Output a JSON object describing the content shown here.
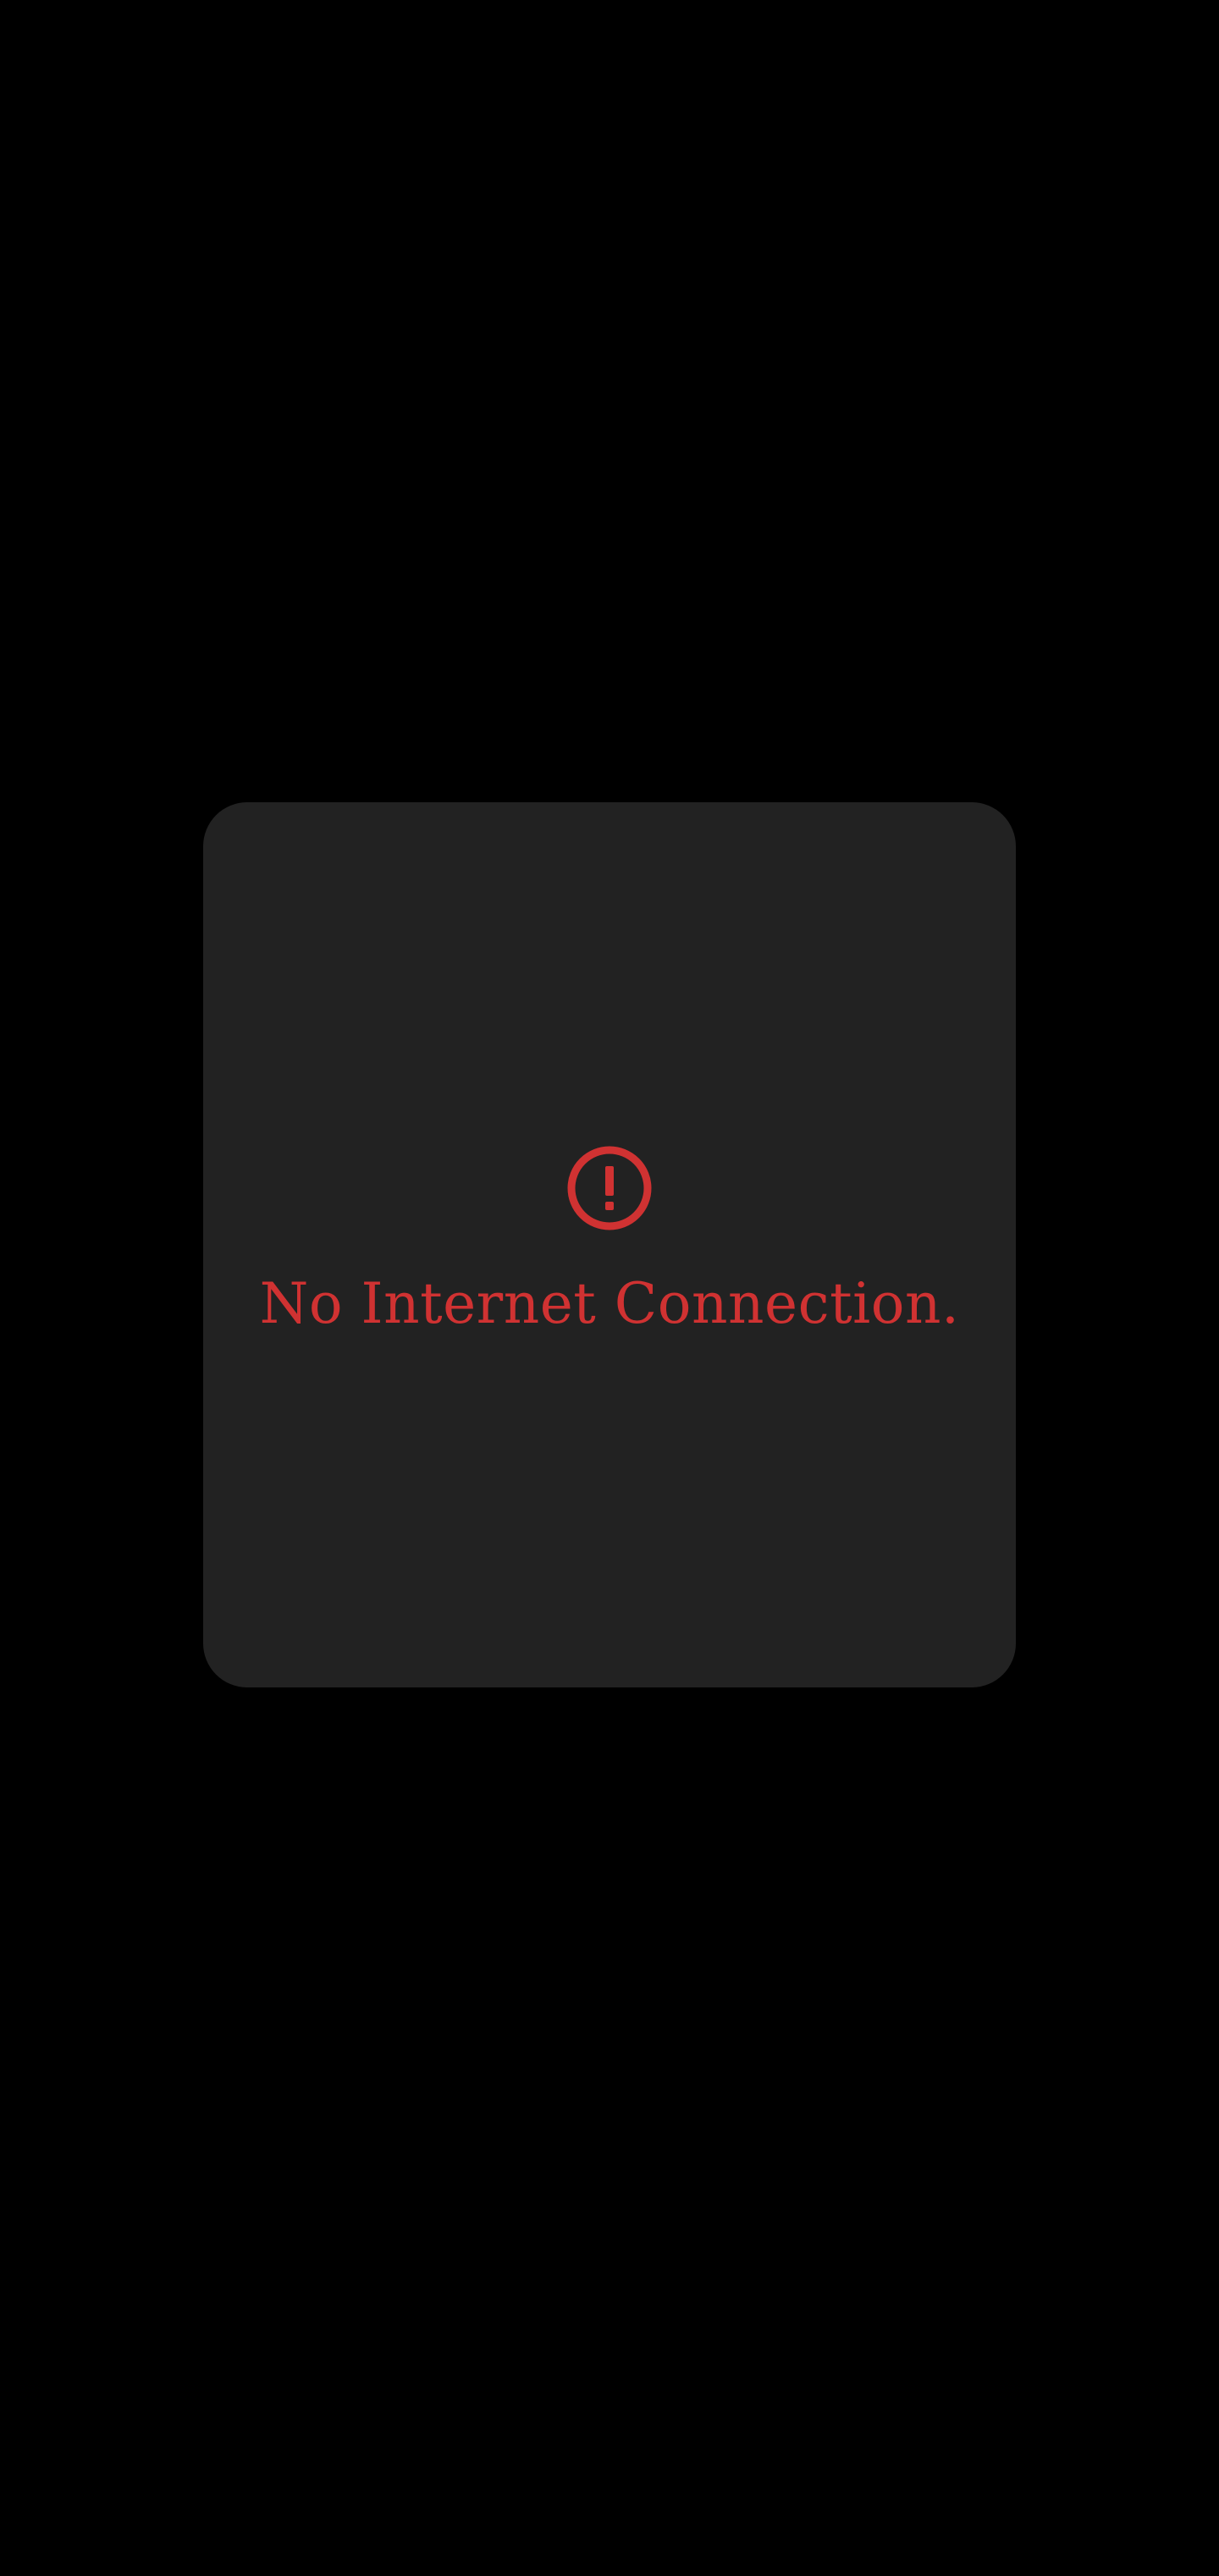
{
  "offline_card": {
    "icon": "alert-circle-icon",
    "message": "No Internet Connection."
  },
  "colors": {
    "page_background": "#000000",
    "card_background": "#222222",
    "accent_error": "#d03232"
  }
}
